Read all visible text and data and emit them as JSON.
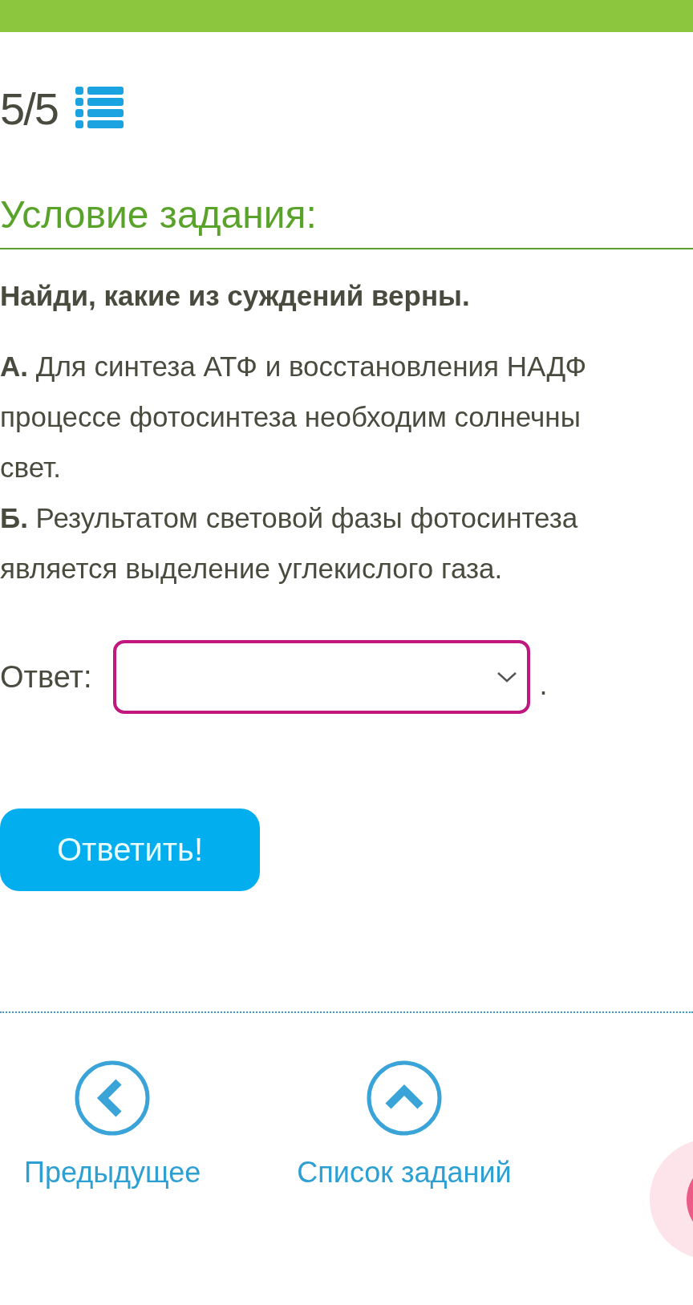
{
  "progress": "5/5",
  "heading": "Условие задания:",
  "question": "Найди, какие из суждений верны.",
  "statements": [
    {
      "text": "**А.** Для синтеза АТФ и восстановления НАДФ\nпроцессе фотосинтеза необходим солнечны\nсвет."
    },
    {
      "text": "**Б.** Результатом световой фазы фотосинтеза\nявляется выделение углекислого газа."
    }
  ],
  "answer": {
    "label": "Ответ:",
    "after": "."
  },
  "submit": "Ответить!",
  "nav": [
    {
      "kind": "previous",
      "label": "Предыдущее"
    },
    {
      "kind": "list",
      "label": "Список заданий"
    }
  ]
}
